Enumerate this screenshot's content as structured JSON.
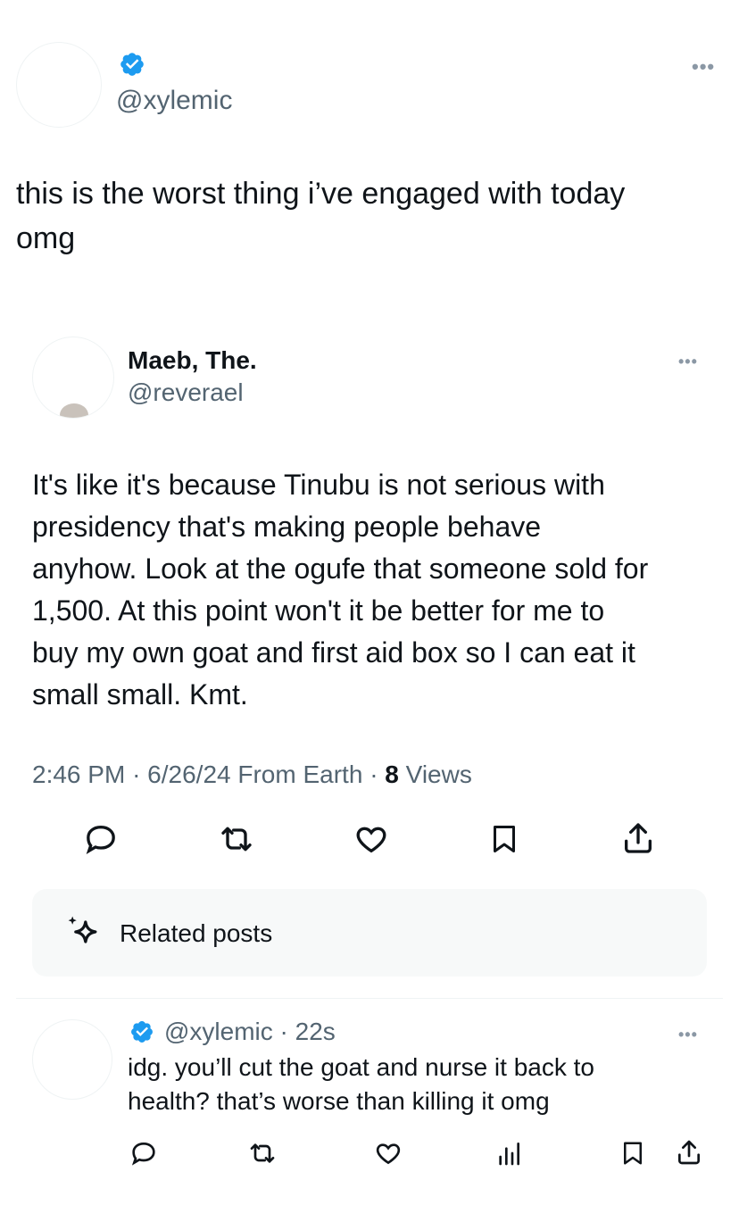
{
  "quote_tweet": {
    "handle": "@xylemic",
    "text_line1": "this is the worst thing i’ve engaged with today",
    "text_line2": "omg"
  },
  "main_tweet": {
    "display_name": "Maeb, The.",
    "handle": "@reverael",
    "lines": [
      "It's like it's because Tinubu is not serious with",
      "presidency that's making people behave",
      "anyhow. Look at the ogufe that someone sold for",
      "1,500. At this point won't it be better for me to",
      "buy my own goat and first aid box so I can eat it",
      "small small. Kmt."
    ],
    "meta": {
      "time": "2:46 PM",
      "date": "6/26/24",
      "source": "From Earth",
      "views_count": "8",
      "views_label": "Views"
    },
    "related_posts_label": "Related posts"
  },
  "reply": {
    "handle": "@xylemic",
    "age": "22s",
    "line1": "idg. you’ll cut the goat and nurse it back to",
    "line2": "health? that’s worse than killing it omg"
  },
  "colors": {
    "verified": "#1d9bf0",
    "text": "#0f1419",
    "muted": "#536471",
    "divider": "#eff3f4",
    "related_bg": "#f7f9f9"
  },
  "icons": [
    "verified-icon",
    "more-icon",
    "reply-icon",
    "retweet-icon",
    "like-icon",
    "bookmark-icon",
    "share-icon",
    "views-icon",
    "sparkle-icon"
  ]
}
